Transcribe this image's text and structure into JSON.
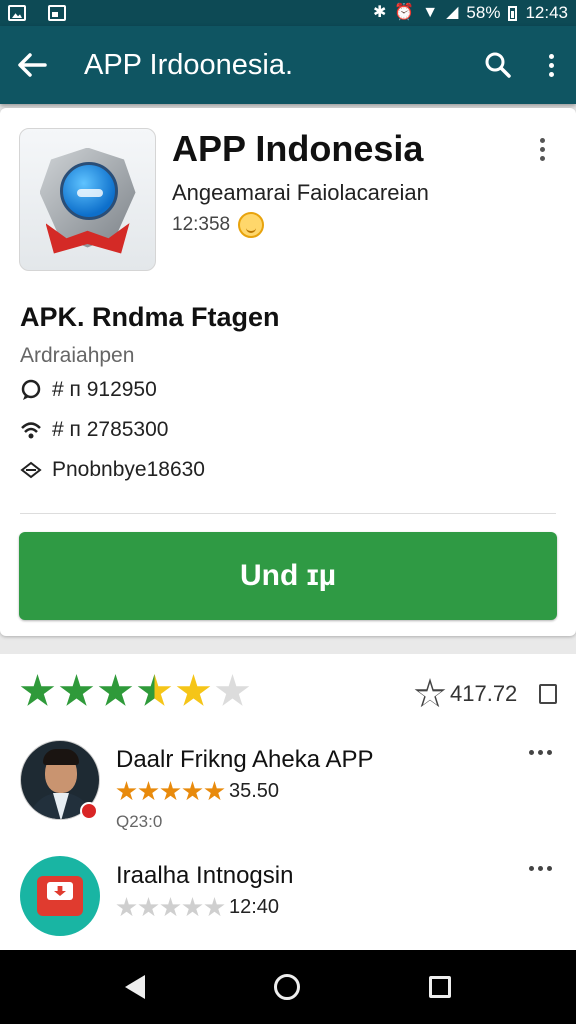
{
  "status_bar": {
    "battery": "58%",
    "time": "12:43"
  },
  "app_bar": {
    "title": "APP Irdoonesia."
  },
  "app": {
    "name": "APP Indonesia",
    "developer": "Angeamarai Faiolacareian",
    "meta": "12:358"
  },
  "details": {
    "heading": "APK. Rndma Ftagen",
    "subtitle": "Ardraiahpen",
    "rows": [
      {
        "icon": "chat-icon",
        "text": "# ᴨ 912950"
      },
      {
        "icon": "wifi-icon",
        "text": "# ᴨ 2785300"
      },
      {
        "icon": "share-icon",
        "text": "Pnobnbye18630"
      }
    ]
  },
  "install_button": "Und ɪµ",
  "rating": {
    "value": 3.5,
    "count": "417.72",
    "colors": {
      "filled": "#2f9a3a",
      "half": "#f5c518",
      "empty": "#dcdcdc"
    }
  },
  "reviews": [
    {
      "name": "Daalr Frikng Aheka APP",
      "score": "35.50",
      "date": "Q23:0",
      "stars": 5,
      "star_color": "#e88a0c"
    },
    {
      "name": "Iraalha Intnogsin",
      "score": "12:40",
      "date": "",
      "stars": 5,
      "star_color": "#cfcfcf"
    }
  ]
}
